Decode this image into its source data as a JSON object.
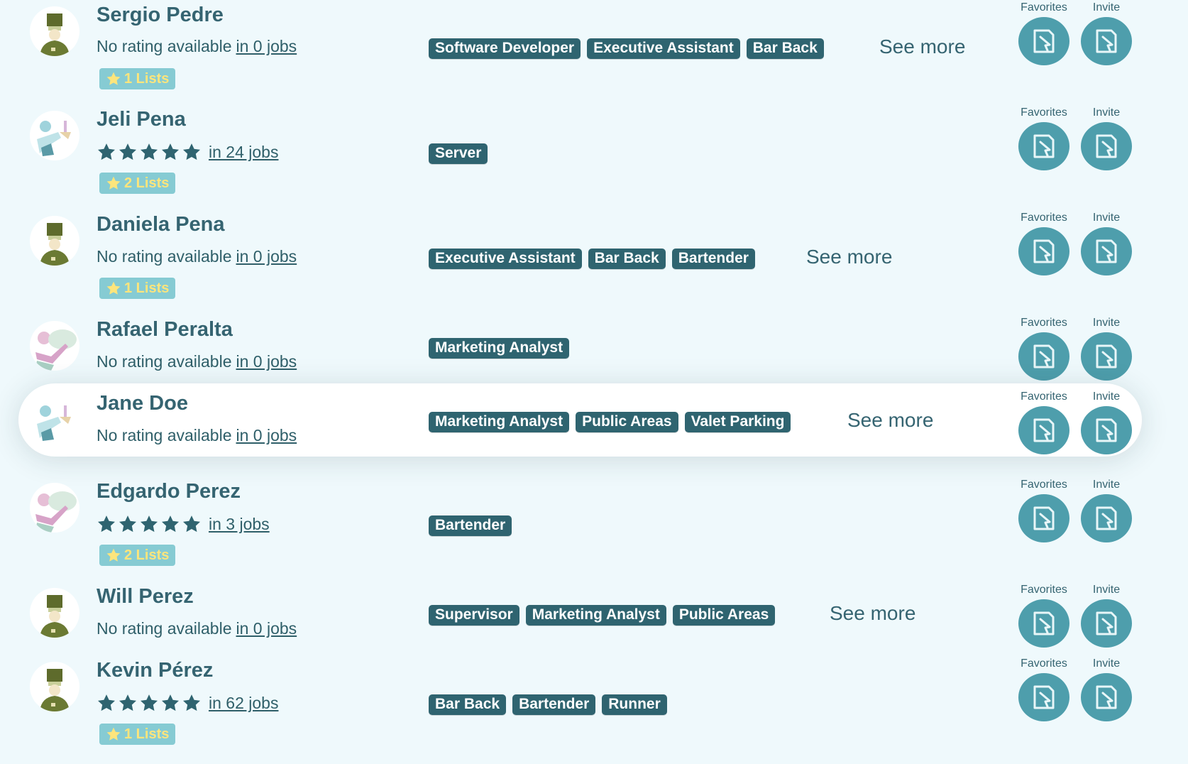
{
  "labels": {
    "favorites": "Favorites",
    "invite": "Invite",
    "see_more": "See more",
    "no_rating": "No rating available"
  },
  "colors": {
    "background": "#eff9fc",
    "tag": "#2f6470",
    "action_button": "#4e9eac",
    "lists_badge": "#86cbd3",
    "lists_badge_text": "#fde57c",
    "star": "#2f6470"
  },
  "workers": [
    {
      "name": "Sergio Pedre",
      "avatar": "chef-avatar",
      "rating_text": "No rating available",
      "stars": 0,
      "jobs": "in 0 jobs",
      "lists": "1 Lists",
      "tags": [
        "Software Developer",
        "Executive Assistant",
        "Bar Back"
      ],
      "see_more": "See more"
    },
    {
      "name": "Jeli Pena",
      "avatar": "waiter-avatar",
      "rating_text": "",
      "stars": 5,
      "jobs": "in 24 jobs",
      "lists": "2 Lists",
      "tags": [
        "Server"
      ],
      "see_more": ""
    },
    {
      "name": "Daniela Pena",
      "avatar": "chef-avatar",
      "rating_text": "No rating available",
      "stars": 0,
      "jobs": "in 0 jobs",
      "lists": "1 Lists",
      "tags": [
        "Executive Assistant",
        "Bar Back",
        "Bartender"
      ],
      "see_more": "See more"
    },
    {
      "name": "Rafael Peralta",
      "avatar": "server-avatar",
      "rating_text": "No rating available",
      "stars": 0,
      "jobs": "in 0 jobs",
      "lists": "",
      "tags": [
        "Marketing Analyst"
      ],
      "see_more": ""
    },
    {
      "name": "Jane Doe",
      "avatar": "waiter-avatar",
      "rating_text": "No rating available",
      "stars": 0,
      "jobs": "in 0 jobs",
      "lists": "",
      "tags": [
        "Marketing Analyst",
        "Public Areas",
        "Valet Parking"
      ],
      "see_more": "See more"
    },
    {
      "name": "Edgardo Perez",
      "avatar": "server-avatar",
      "rating_text": "",
      "stars": 5,
      "jobs": "in 3 jobs",
      "lists": "2 Lists",
      "tags": [
        "Bartender"
      ],
      "see_more": ""
    },
    {
      "name": "Will Perez",
      "avatar": "chef-avatar",
      "rating_text": "No rating available",
      "stars": 0,
      "jobs": "in 0 jobs",
      "lists": "",
      "tags": [
        "Supervisor",
        "Marketing Analyst",
        "Public Areas"
      ],
      "see_more": "See more"
    },
    {
      "name": "Kevin Pérez",
      "avatar": "chef-avatar",
      "rating_text": "",
      "stars": 5,
      "jobs": "in 62 jobs",
      "lists": "1 Lists",
      "tags": [
        "Bar Back",
        "Bartender",
        "Runner"
      ],
      "see_more": ""
    }
  ]
}
